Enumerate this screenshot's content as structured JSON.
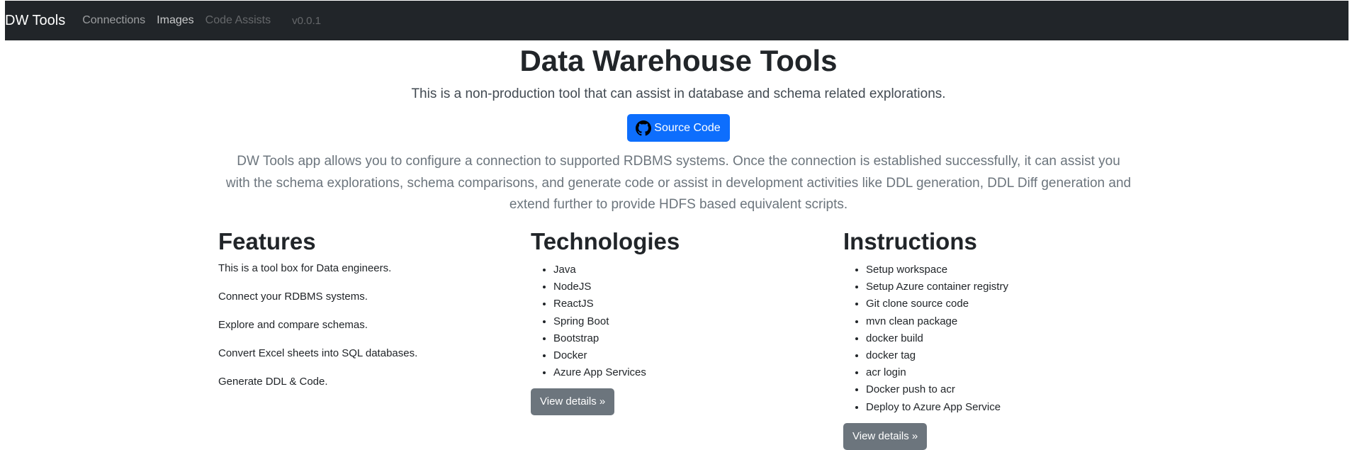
{
  "navbar": {
    "brand": "DW Tools",
    "links": [
      "Connections",
      "Images",
      "Code Assists"
    ],
    "version": "v0.0.1"
  },
  "hero": {
    "title": "Data Warehouse Tools",
    "lead": "This is a non-production tool that can assist in database and schema related explorations.",
    "source_button": "Source Code",
    "source_icon": "github-icon",
    "description": "DW Tools app allows you to configure a connection to supported RDBMS systems. Once the connection is established successfully, it can assist you with the schema explorations, schema comparisons, and generate code or assist in development activities like DDL generation, DDL Diff generation and extend further to provide HDFS based equivalent scripts."
  },
  "features": {
    "heading": "Features",
    "items": [
      "This is a tool box for Data engineers.",
      "Connect your RDBMS systems.",
      "Explore and compare schemas.",
      "Convert Excel sheets into SQL databases.",
      "Generate DDL & Code."
    ]
  },
  "technologies": {
    "heading": "Technologies",
    "items": [
      "Java",
      "NodeJS",
      "ReactJS",
      "Spring Boot",
      "Bootstrap",
      "Docker",
      "Azure App Services"
    ],
    "button": "View details »"
  },
  "instructions": {
    "heading": "Instructions",
    "items": [
      "Setup workspace",
      "Setup Azure container registry",
      "Git clone source code",
      "mvn clean package",
      "docker build",
      "docker tag",
      "acr login",
      "Docker push to acr",
      "Deploy to Azure App Service"
    ],
    "button": "View details »"
  },
  "colors": {
    "navbar_bg": "#212529",
    "primary": "#0d6efd",
    "secondary": "#6c757d"
  }
}
